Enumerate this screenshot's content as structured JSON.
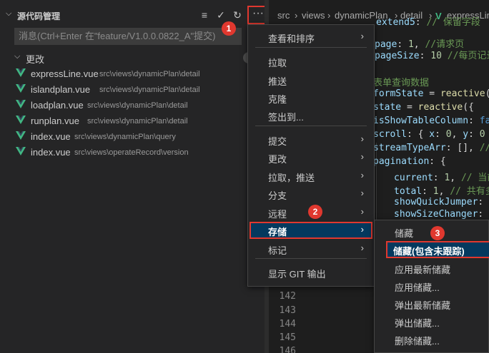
{
  "sidebar": {
    "title": "源代码管理",
    "commit_placeholder": "消息(Ctrl+Enter 在\"feature/V1.0.0.0822_A\"提交)",
    "changes_label": "更改",
    "files": [
      {
        "name": "expressLine.vue",
        "path": "src\\views\\dynamicPlan\\detail"
      },
      {
        "name": "islandplan.vue",
        "path": "src\\views\\dynamicPlan\\detail"
      },
      {
        "name": "loadplan.vue",
        "path": "src\\views\\dynamicPlan\\detail"
      },
      {
        "name": "runplan.vue",
        "path": "src\\views\\dynamicPlan\\detail"
      },
      {
        "name": "index.vue",
        "path": "src\\views\\dynamicPlan\\query"
      },
      {
        "name": "index.vue",
        "path": "src\\views\\operateRecord\\version"
      }
    ]
  },
  "breadcrumb": [
    "src",
    "views",
    "dynamicPlan",
    "detail",
    "expressLin"
  ],
  "code": {
    "line_numbers": [
      "142",
      "143",
      "144",
      "145",
      "146"
    ]
  },
  "main_menu": {
    "items": [
      {
        "label": "查看和排序",
        "submenu": true
      },
      {
        "label": "拉取",
        "submenu": false
      },
      {
        "label": "推送",
        "submenu": false
      },
      {
        "label": "克隆",
        "submenu": false
      },
      {
        "label": "签出到...",
        "submenu": false
      },
      {
        "label": "提交",
        "submenu": true
      },
      {
        "label": "更改",
        "submenu": true
      },
      {
        "label": "拉取，推送",
        "submenu": true
      },
      {
        "label": "分支",
        "submenu": true
      },
      {
        "label": "远程",
        "submenu": true
      },
      {
        "label": "存储",
        "submenu": true
      },
      {
        "label": "标记",
        "submenu": true
      },
      {
        "label": "显示 GIT 输出",
        "submenu": false
      }
    ]
  },
  "stash_menu": {
    "items": [
      "储藏",
      "储藏(包含未跟踪)",
      "应用最新储藏",
      "应用储藏...",
      "弹出最新储藏",
      "弹出储藏...",
      "删除储藏..."
    ]
  },
  "badges": [
    "1",
    "2",
    "3"
  ],
  "colors": {
    "accent": "#e0382f",
    "selection": "#04395e",
    "vue_green": "#41b883"
  }
}
